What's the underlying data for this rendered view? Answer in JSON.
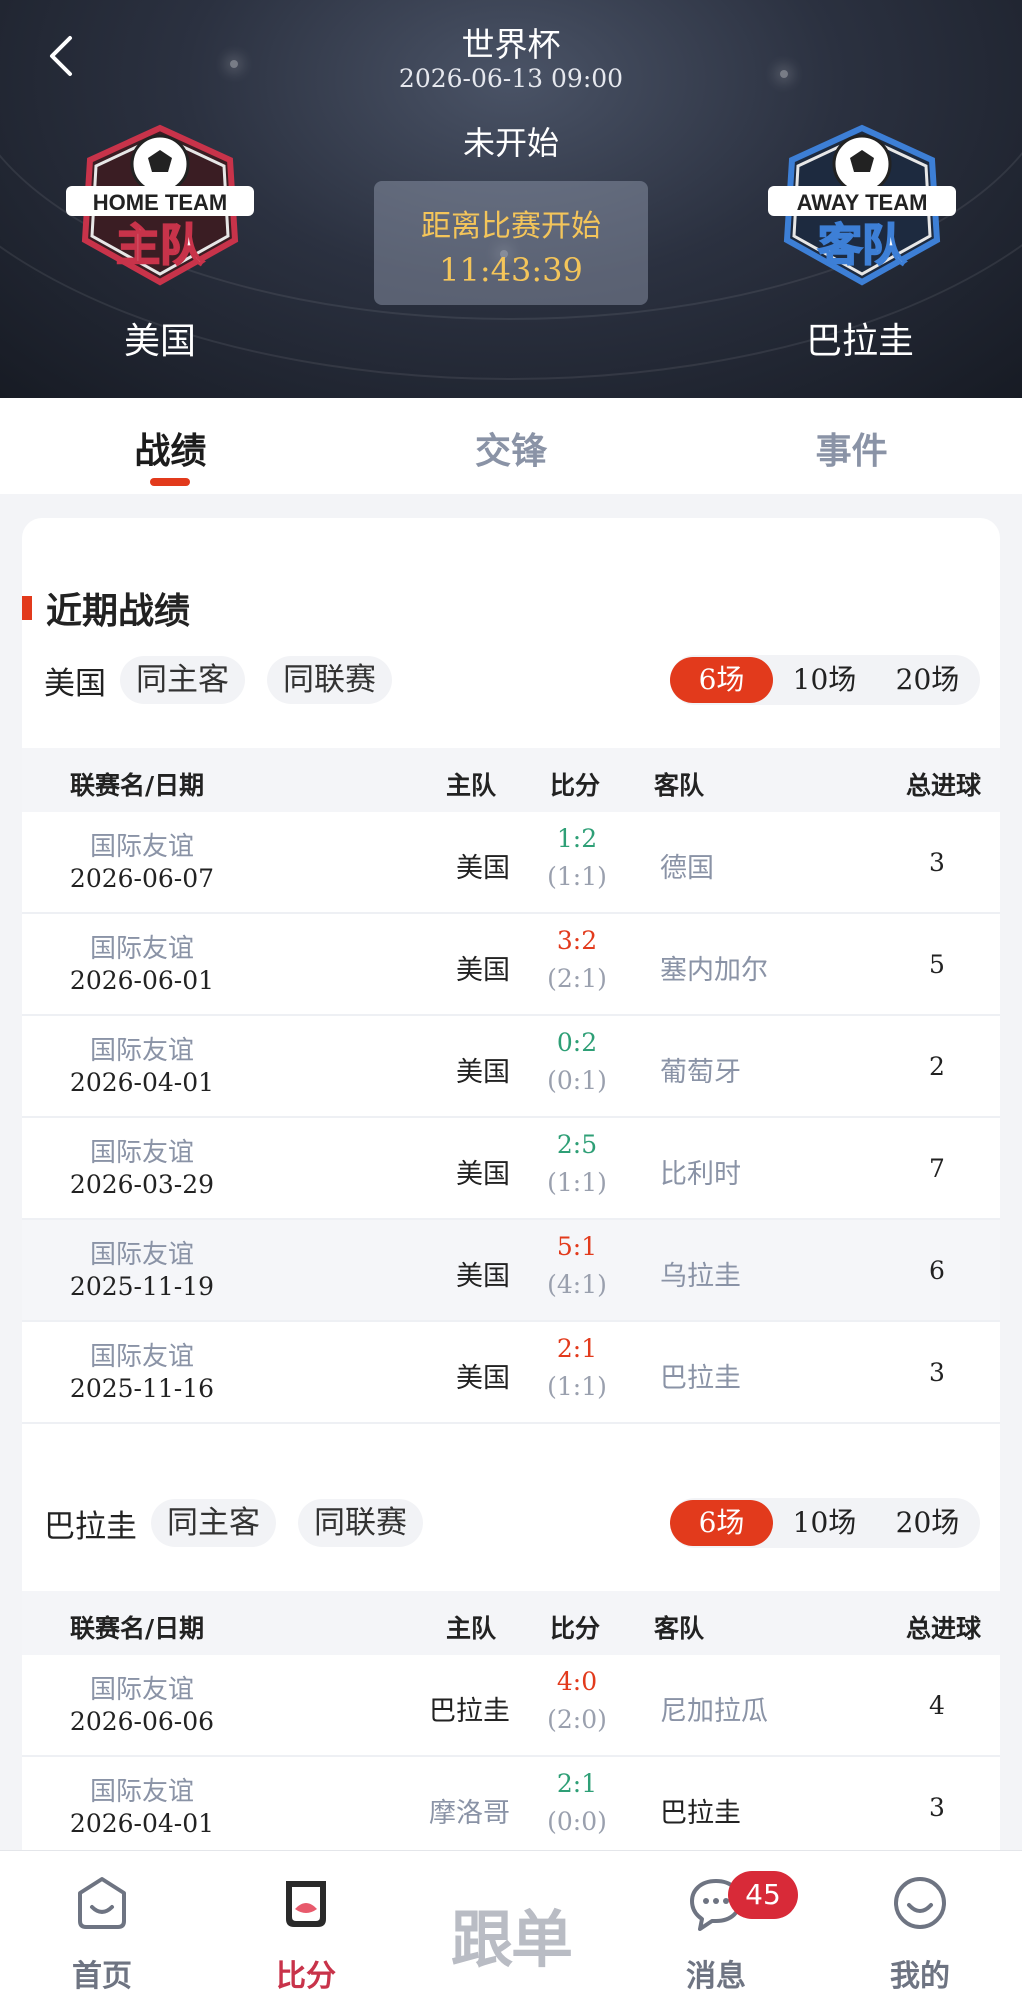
{
  "header": {
    "league": "世界杯",
    "datetime": "2026-06-13 09:00",
    "status": "未开始",
    "countdown_label": "距离比赛开始",
    "countdown_time": "11:43:39",
    "home": {
      "badge_top": "HOME TEAM",
      "badge_main": "主队",
      "name": "美国"
    },
    "away": {
      "badge_top": "AWAY TEAM",
      "badge_main": "客队",
      "name": "巴拉圭"
    }
  },
  "tabs": [
    {
      "label": "战绩",
      "active": true
    },
    {
      "label": "交锋",
      "active": false
    },
    {
      "label": "事件",
      "active": false
    }
  ],
  "section": {
    "title": "近期战绩"
  },
  "columns": {
    "league_date": "联赛名/日期",
    "home": "主队",
    "score": "比分",
    "away": "客队",
    "total": "总进球"
  },
  "groups": [
    {
      "team": "美国",
      "chips": [
        "同主客",
        "同联赛"
      ],
      "ranges": [
        "6场",
        "10场",
        "20场"
      ],
      "active_range": "6场",
      "rows": [
        {
          "league": "国际友谊",
          "date": "2026-06-07",
          "home": "美国",
          "score": "1:2",
          "half": "(1:1)",
          "away": "德国",
          "total": "3"
        },
        {
          "league": "国际友谊",
          "date": "2026-06-01",
          "home": "美国",
          "score": "3:2",
          "half": "(2:1)",
          "away": "塞内加尔",
          "total": "5"
        },
        {
          "league": "国际友谊",
          "date": "2026-04-01",
          "home": "美国",
          "score": "0:2",
          "half": "(0:1)",
          "away": "葡萄牙",
          "total": "2"
        },
        {
          "league": "国际友谊",
          "date": "2026-03-29",
          "home": "美国",
          "score": "2:5",
          "half": "(1:1)",
          "away": "比利时",
          "total": "7"
        },
        {
          "league": "国际友谊",
          "date": "2025-11-19",
          "home": "美国",
          "score": "5:1",
          "half": "(4:1)",
          "away": "乌拉圭",
          "total": "6"
        },
        {
          "league": "国际友谊",
          "date": "2025-11-16",
          "home": "美国",
          "score": "2:1",
          "half": "(1:1)",
          "away": "巴拉圭",
          "total": "3"
        }
      ]
    },
    {
      "team": "巴拉圭",
      "chips": [
        "同主客",
        "同联赛"
      ],
      "ranges": [
        "6场",
        "10场",
        "20场"
      ],
      "active_range": "6场",
      "rows": [
        {
          "league": "国际友谊",
          "date": "2026-06-06",
          "home": "巴拉圭",
          "score": "4:0",
          "half": "(2:0)",
          "away": "尼加拉瓜",
          "total": "4"
        },
        {
          "league": "国际友谊",
          "date": "2026-04-01",
          "home": "摩洛哥",
          "score": "2:1",
          "half": "(0:0)",
          "away": "巴拉圭",
          "total": "3"
        }
      ]
    }
  ],
  "nav": {
    "items": [
      {
        "label": "首页"
      },
      {
        "label": "比分"
      },
      {
        "label": "跟单"
      },
      {
        "label": "消息",
        "badge": "45"
      },
      {
        "label": "我的"
      }
    ]
  },
  "colors": {
    "accent": "#e23a1c",
    "win": "#e23a1c",
    "lose": "#2e9f76",
    "nav_active": "#c8334a",
    "countdown": "#f4c55a"
  }
}
